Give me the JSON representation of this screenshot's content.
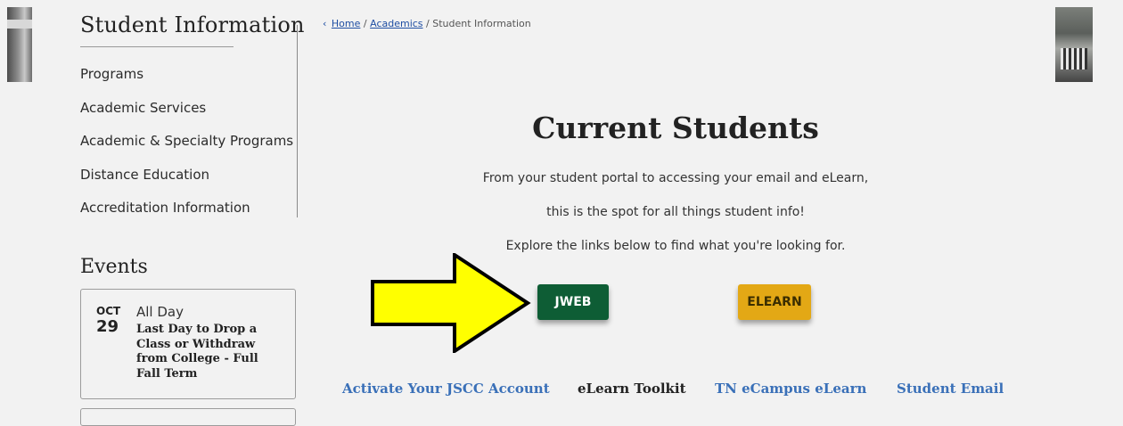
{
  "sidebar": {
    "title": "Student Information",
    "items": [
      {
        "label": "Programs"
      },
      {
        "label": "Academic Services"
      },
      {
        "label": "Academic & Specialty Programs"
      },
      {
        "label": "Distance Education"
      },
      {
        "label": "Accreditation Information"
      }
    ]
  },
  "events": {
    "title": "Events",
    "items": [
      {
        "month": "OCT",
        "day": "29",
        "time": "All Day",
        "title": "Last Day to Drop a Class or Withdraw from College - Full Fall Term"
      }
    ]
  },
  "breadcrumb": {
    "chevron": "‹",
    "home": "Home",
    "sep1": "/",
    "academics": "Academics",
    "sep2": "/",
    "current": "Student Information"
  },
  "main": {
    "title": "Current Students",
    "intro": [
      "From your student portal to accessing your email and eLearn,",
      "this is the spot for all things student info!",
      "Explore the links below to find what you're looking for."
    ],
    "buttons": {
      "jweb": "JWEB",
      "elearn": "ELEARN"
    },
    "links": [
      {
        "label": "Activate Your JSCC Account"
      },
      {
        "label": "eLearn Toolkit"
      },
      {
        "label": "TN eCampus eLearn"
      },
      {
        "label": "Student Email"
      }
    ]
  },
  "colors": {
    "jweb": "#0e5d35",
    "elearn": "#e3a815",
    "link": "#3a70b8",
    "arrow": "#ffff00"
  },
  "icons": {
    "breadcrumb_chevron": "chevron-left-icon",
    "annotation_arrow": "arrow-right-icon"
  }
}
